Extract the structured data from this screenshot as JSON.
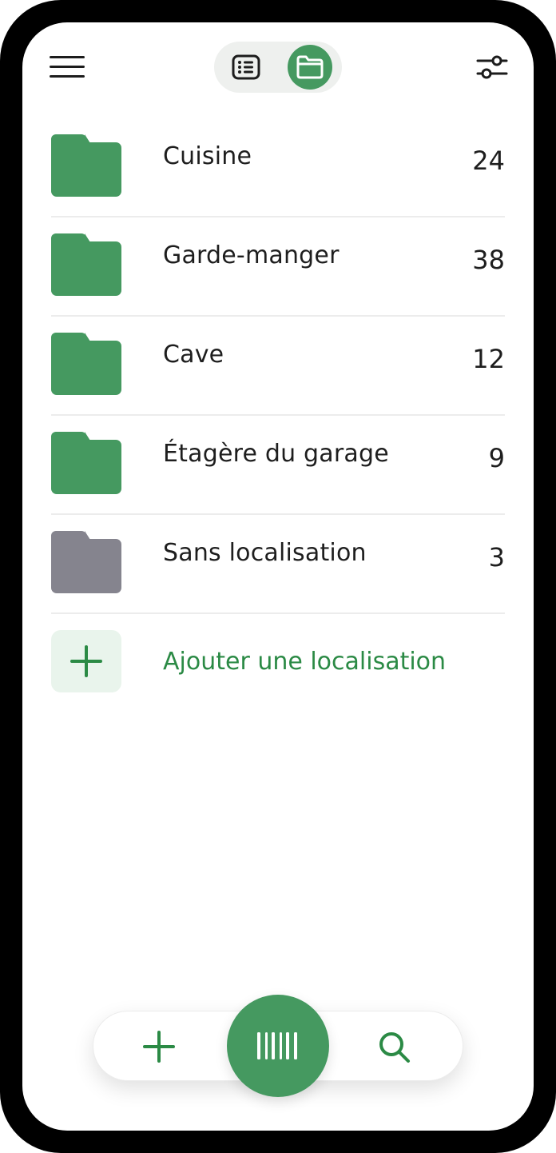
{
  "header": {
    "menu_icon": "hamburger-menu-icon",
    "view_toggle": {
      "list_icon": "list-view-icon",
      "folder_icon": "folder-view-icon",
      "active": "folder"
    },
    "filter_icon": "sliders-filter-icon"
  },
  "locations": [
    {
      "name": "Cuisine",
      "count": "24",
      "color": "#459960"
    },
    {
      "name": "Garde-manger",
      "count": "38",
      "color": "#459960"
    },
    {
      "name": "Cave",
      "count": "12",
      "color": "#459960"
    },
    {
      "name": "Étagère du garage",
      "count": "9",
      "color": "#459960"
    },
    {
      "name": "Sans localisation",
      "count": "3",
      "color": "#85848e"
    }
  ],
  "add_location": {
    "label": "Ajouter une localisation",
    "icon": "plus-icon"
  },
  "bottom_bar": {
    "add_icon": "plus-icon",
    "scan_icon": "barcode-icon",
    "search_icon": "search-icon"
  },
  "colors": {
    "accent": "#459960",
    "accent_text": "#2b8a45",
    "accent_light": "#e9f4ec",
    "neutral_folder": "#85848e"
  }
}
